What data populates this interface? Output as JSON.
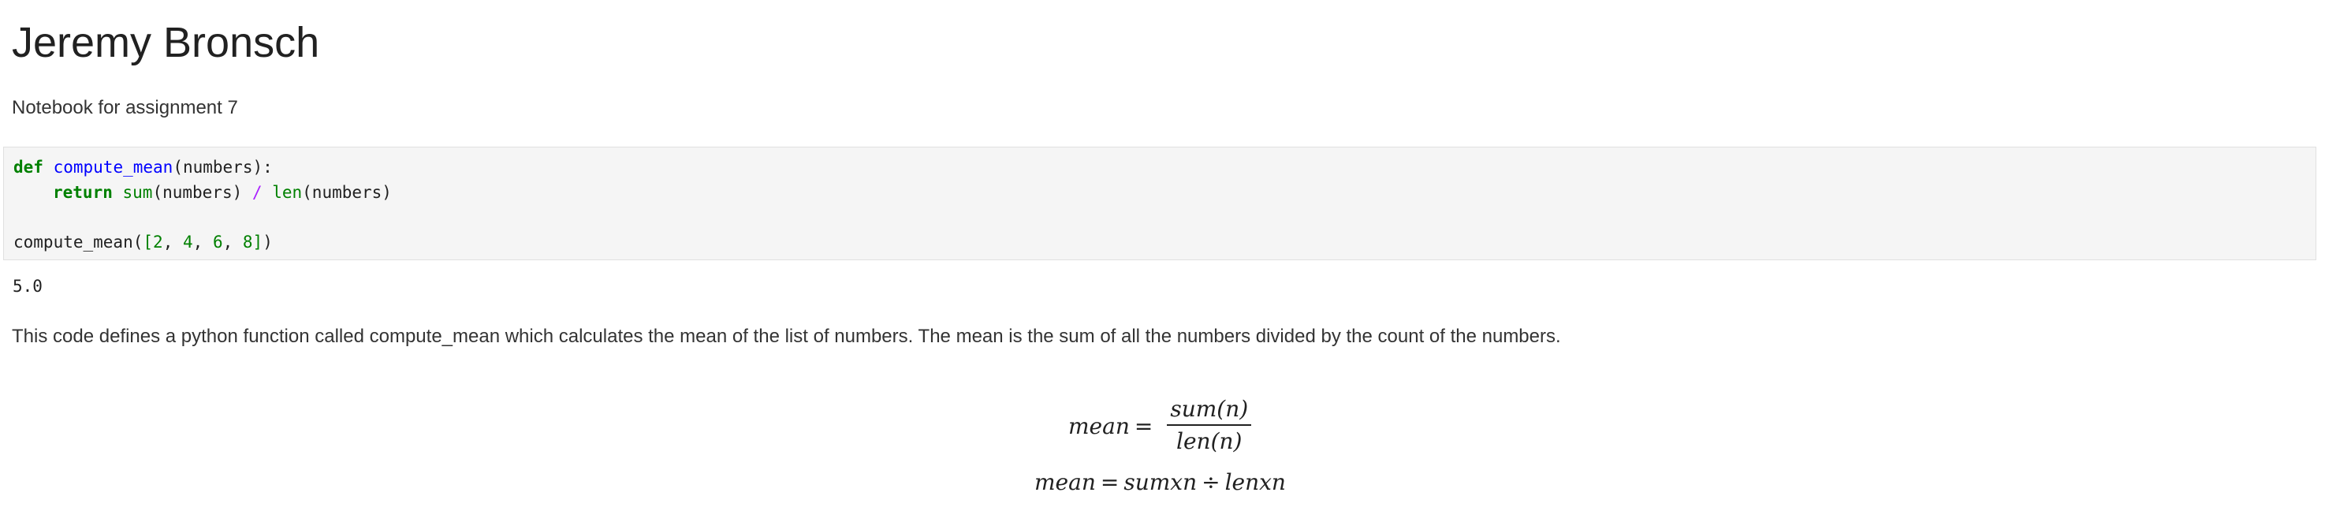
{
  "notebook": {
    "title": "Jeremy Bronsch",
    "subtitle": "Notebook for assignment 7",
    "code_cell": {
      "line1": {
        "kw_def": "def",
        "fn_name": "compute_mean",
        "params": "(numbers):"
      },
      "line2": {
        "kw_return": "return",
        "fn_sum": "sum",
        "arg1": "(numbers)",
        "op_div": "/",
        "fn_len": "len",
        "arg2": "(numbers)"
      },
      "line4": {
        "call_name": "compute_mean(",
        "open_bracket": "[",
        "n1": "2",
        "sep1": ", ",
        "n2": "4",
        "sep2": ", ",
        "n3": "6",
        "sep3": ", ",
        "n4": "8",
        "close_bracket": "]",
        "close_paren": ")"
      }
    },
    "output": "5.0",
    "description": "This code defines a python function called compute_mean which calculates the mean of the list of numbers. The mean is the sum of all the numbers divided by the count of the numbers.",
    "equation1": {
      "lhs": "mean",
      "equals": "=",
      "numerator": "sum(n)",
      "denominator": "len(n)"
    },
    "equation2": {
      "lhs": "mean",
      "equals": "=",
      "left_term": "sumxn",
      "divide": "÷",
      "right_term": "lenxn"
    }
  }
}
